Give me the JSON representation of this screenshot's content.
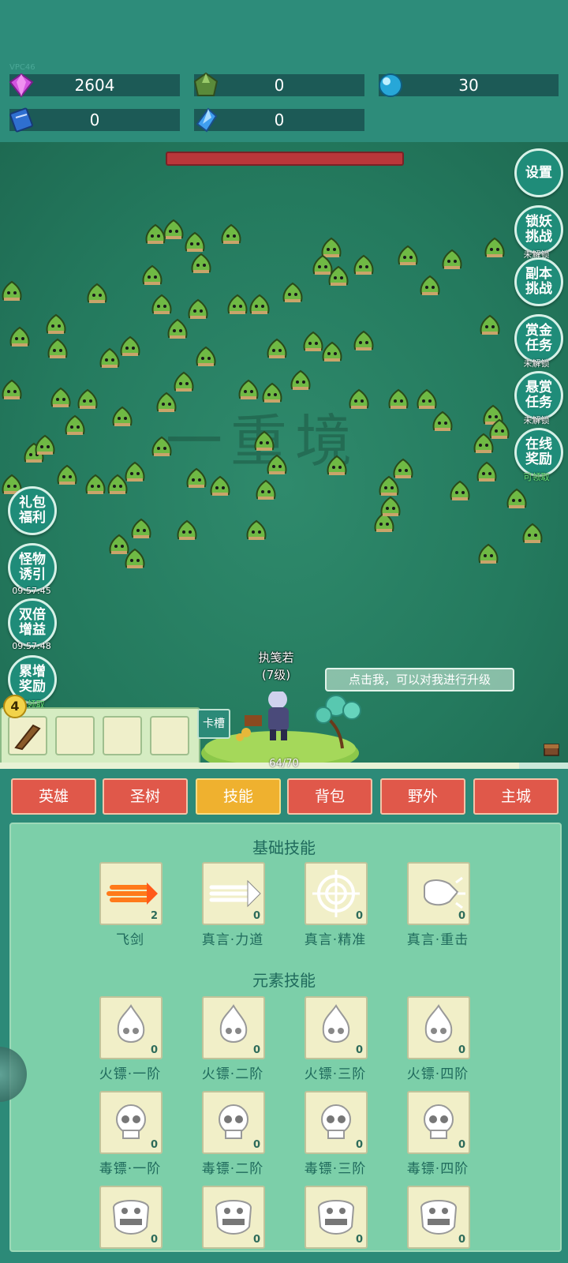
{
  "resources": {
    "vpc_label": "VPC46",
    "gem": "2604",
    "green_crystal": "0",
    "orb": "30",
    "book": "0",
    "blue_crystal": "0"
  },
  "right_menu": [
    {
      "label": "设置",
      "sub": ""
    },
    {
      "label": "锁妖挑战",
      "sub": "未解锁"
    },
    {
      "label": "副本挑战",
      "sub": ""
    },
    {
      "label": "赏金任务",
      "sub": "未解锁"
    },
    {
      "label": "悬赏任务",
      "sub": "未解锁"
    },
    {
      "label": "在线奖励",
      "sub": "可领取"
    }
  ],
  "left_menu": [
    {
      "label": "礼包福利",
      "sub": ""
    },
    {
      "label": "怪物诱引",
      "sub": "09:57:45"
    },
    {
      "label": "双倍增益",
      "sub": "09:57:48"
    },
    {
      "label": "累增奖励",
      "sub": "可领取"
    }
  ],
  "watermark": "一重境",
  "hero": {
    "name": "执笺若",
    "level": "(7级)"
  },
  "tip": "点击我，可以对我进行升级",
  "card_slots": {
    "count_badge": "4",
    "slot_button": "卡槽"
  },
  "hp": {
    "text": "64/70",
    "fraction": 0.914
  },
  "tabs": [
    "英雄",
    "圣树",
    "技能",
    "背包",
    "野外",
    "主城"
  ],
  "active_tab": "技能",
  "sections": {
    "basic_title": "基础技能",
    "element_title": "元素技能"
  },
  "basic_skills": [
    {
      "name": "飞剑",
      "level": "2",
      "icon": "flying-sword-icon"
    },
    {
      "name": "真言·力道",
      "level": "0",
      "icon": "triple-arrow-icon"
    },
    {
      "name": "真言·精准",
      "level": "0",
      "icon": "crosshair-icon"
    },
    {
      "name": "真言·重击",
      "level": "0",
      "icon": "fist-icon"
    }
  ],
  "fire_skills": [
    {
      "name": "火镖·一阶",
      "level": "0"
    },
    {
      "name": "火镖·二阶",
      "level": "0"
    },
    {
      "name": "火镖·三阶",
      "level": "0"
    },
    {
      "name": "火镖·四阶",
      "level": "0"
    }
  ],
  "poison_skills": [
    {
      "name": "毒镖·一阶",
      "level": "0"
    },
    {
      "name": "毒镖·二阶",
      "level": "0"
    },
    {
      "name": "毒镖·三阶",
      "level": "0"
    },
    {
      "name": "毒镖·四阶",
      "level": "0"
    }
  ],
  "fourth_row_skills": [
    {
      "name": "",
      "level": "0"
    },
    {
      "name": "",
      "level": "0"
    },
    {
      "name": "",
      "level": "0"
    },
    {
      "name": "",
      "level": "0"
    }
  ],
  "colors": {
    "tab": "#e0584a",
    "tab_active": "#efb12f",
    "panel": "#7ccfa9",
    "mob": "#6fb944"
  }
}
